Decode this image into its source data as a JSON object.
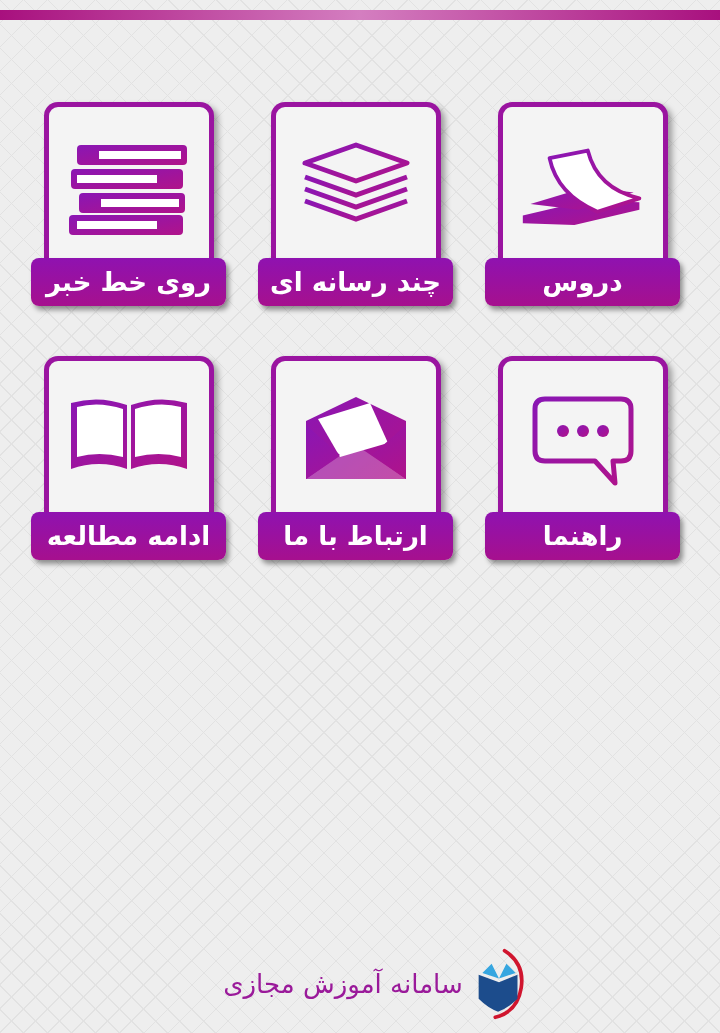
{
  "tiles": [
    {
      "label": "دروس"
    },
    {
      "label": "چند رسانه ای"
    },
    {
      "label": "روی خط خبر"
    },
    {
      "label": "راهنما"
    },
    {
      "label": "ارتباط با ما"
    },
    {
      "label": "ادامه مطالعه"
    }
  ],
  "footer": {
    "title": "سامانه آموزش مجازی"
  }
}
